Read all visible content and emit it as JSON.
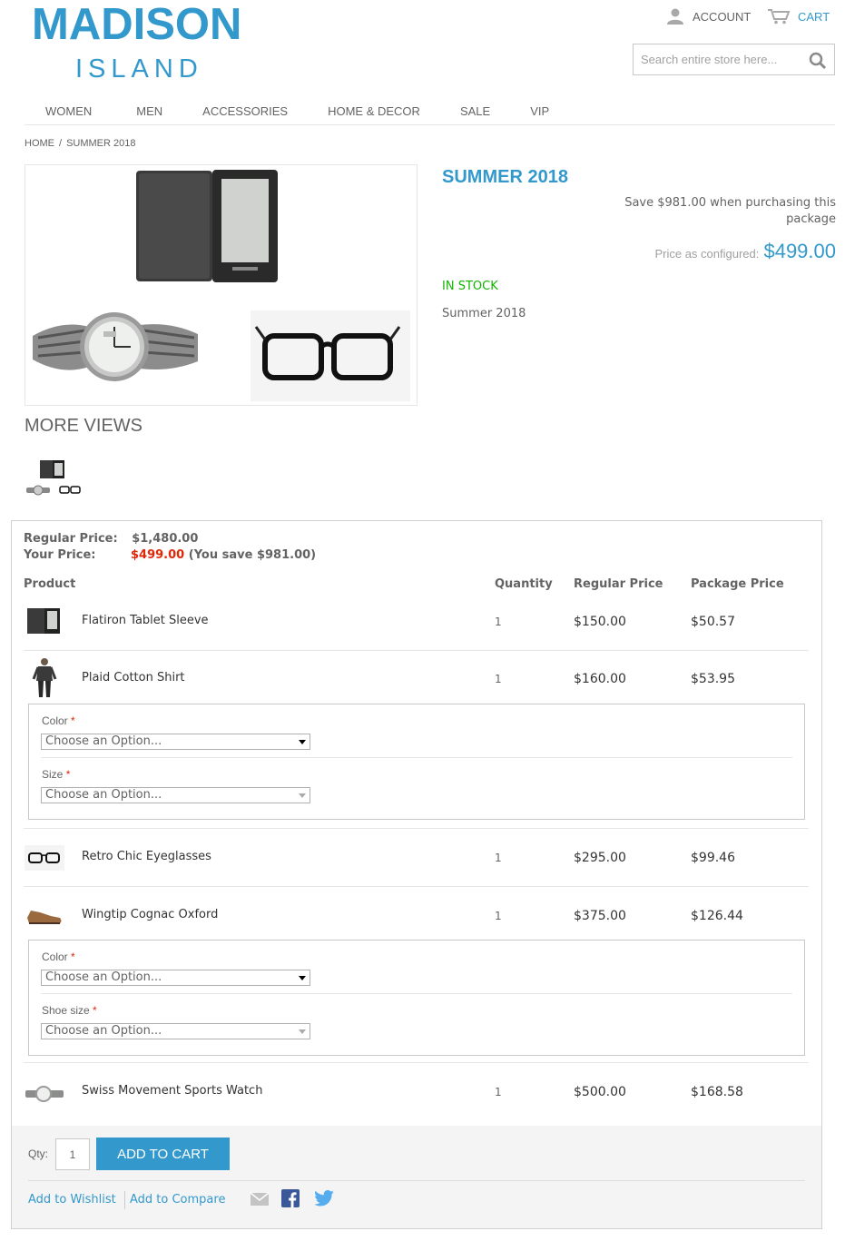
{
  "header": {
    "logo_main": "MADISON",
    "logo_sub": "ISLAND",
    "account_label": "ACCOUNT",
    "cart_label": "CART",
    "search_placeholder": "Search entire store here..."
  },
  "nav": {
    "items": [
      "WOMEN",
      "MEN",
      "ACCESSORIES",
      "HOME & DECOR",
      "SALE",
      "VIP"
    ]
  },
  "breadcrumb": {
    "home": "HOME",
    "sep": "/",
    "current": "SUMMER 2018"
  },
  "product": {
    "name": "SUMMER 2018",
    "save_text": "Save $981.00 when purchasing this package",
    "price_label": "Price as configured:",
    "price_value": "$499.00",
    "stock": "IN STOCK",
    "short_desc": "Summer 2018",
    "more_views": "MORE VIEWS"
  },
  "bundle": {
    "regular_label": "Regular Price:",
    "regular_value": "$1,480.00",
    "your_label": "Your Price:",
    "your_value": "$499.00",
    "you_save": "(You save $981.00)",
    "headers": {
      "product": "Product",
      "quantity": "Quantity",
      "regular": "Regular Price",
      "package": "Package Price"
    },
    "rows": [
      {
        "name": "Flatiron Tablet Sleeve",
        "qty": "1",
        "regular": "$150.00",
        "package": "$50.57"
      },
      {
        "name": "Plaid Cotton Shirt",
        "qty": "1",
        "regular": "$160.00",
        "package": "$53.95"
      },
      {
        "name": "Retro Chic Eyeglasses",
        "qty": "1",
        "regular": "$295.00",
        "package": "$99.46"
      },
      {
        "name": "Wingtip Cognac Oxford",
        "qty": "1",
        "regular": "$375.00",
        "package": "$126.44"
      },
      {
        "name": "Swiss Movement Sports Watch",
        "qty": "1",
        "regular": "$500.00",
        "package": "$168.58"
      }
    ],
    "shirt_options": {
      "color_label": "Color",
      "size_label": "Size",
      "placeholder": "Choose an Option..."
    },
    "shoe_options": {
      "color_label": "Color",
      "size_label": "Shoe size",
      "placeholder": "Choose an Option..."
    },
    "required_mark": "*"
  },
  "cart": {
    "qty_label": "Qty:",
    "qty_value": "1",
    "add_to_cart": "ADD TO CART",
    "wishlist": "Add to Wishlist",
    "compare": "Add to Compare"
  },
  "colors": {
    "accent": "#3399cc",
    "in_stock": "#11b400",
    "sale_red": "#df280a"
  }
}
